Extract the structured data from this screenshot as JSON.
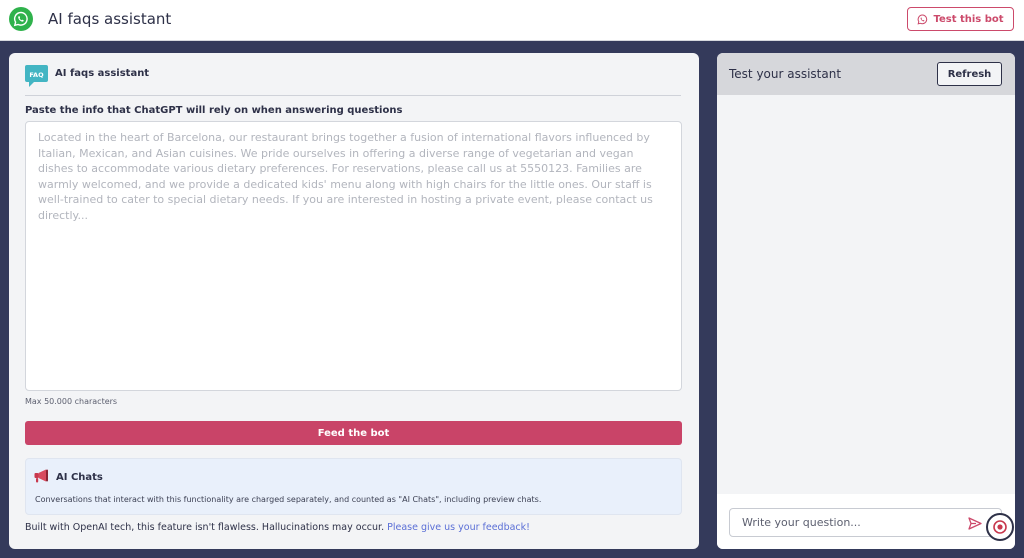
{
  "header": {
    "title": "AI faqs assistant",
    "logo_icon": "whatsapp-icon",
    "test_button_label": "Test this bot",
    "accent_color": "#cc4a6b"
  },
  "left_panel": {
    "badge_icon": "faq-icon",
    "badge_text": "FAQ",
    "title": "AI faqs assistant",
    "paste_label": "Paste the info that ChatGPT will rely on when answering questions",
    "info_placeholder": "Located in the heart of Barcelona, our restaurant brings together a fusion of international flavors influenced by Italian, Mexican, and Asian cuisines. We pride ourselves in offering a diverse range of vegetarian and vegan dishes to accommodate various dietary preferences. For reservations, please call us at 5550123. Families are warmly welcomed, and we provide a dedicated kids' menu along with high chairs for the little ones. Our staff is well-trained to cater to special dietary needs. If you are interested in hosting a private event, please contact us directly...",
    "max_chars": "Max 50.000 characters",
    "feed_button_label": "Feed the bot",
    "ai_chats": {
      "icon": "megaphone-icon",
      "title": "AI Chats",
      "description": "Conversations that interact with this functionality are charged separately, and counted as \"AI Chats\", including preview chats."
    },
    "footer_text": "Built with OpenAI tech, this feature isn't flawless. Hallucinations may occur.",
    "feedback_link": "Please give us your feedback!"
  },
  "right_panel": {
    "title": "Test your assistant",
    "refresh_label": "Refresh",
    "question_placeholder": "Write your question...",
    "send_icon": "send-icon"
  },
  "help_icon": "help-chat-icon"
}
